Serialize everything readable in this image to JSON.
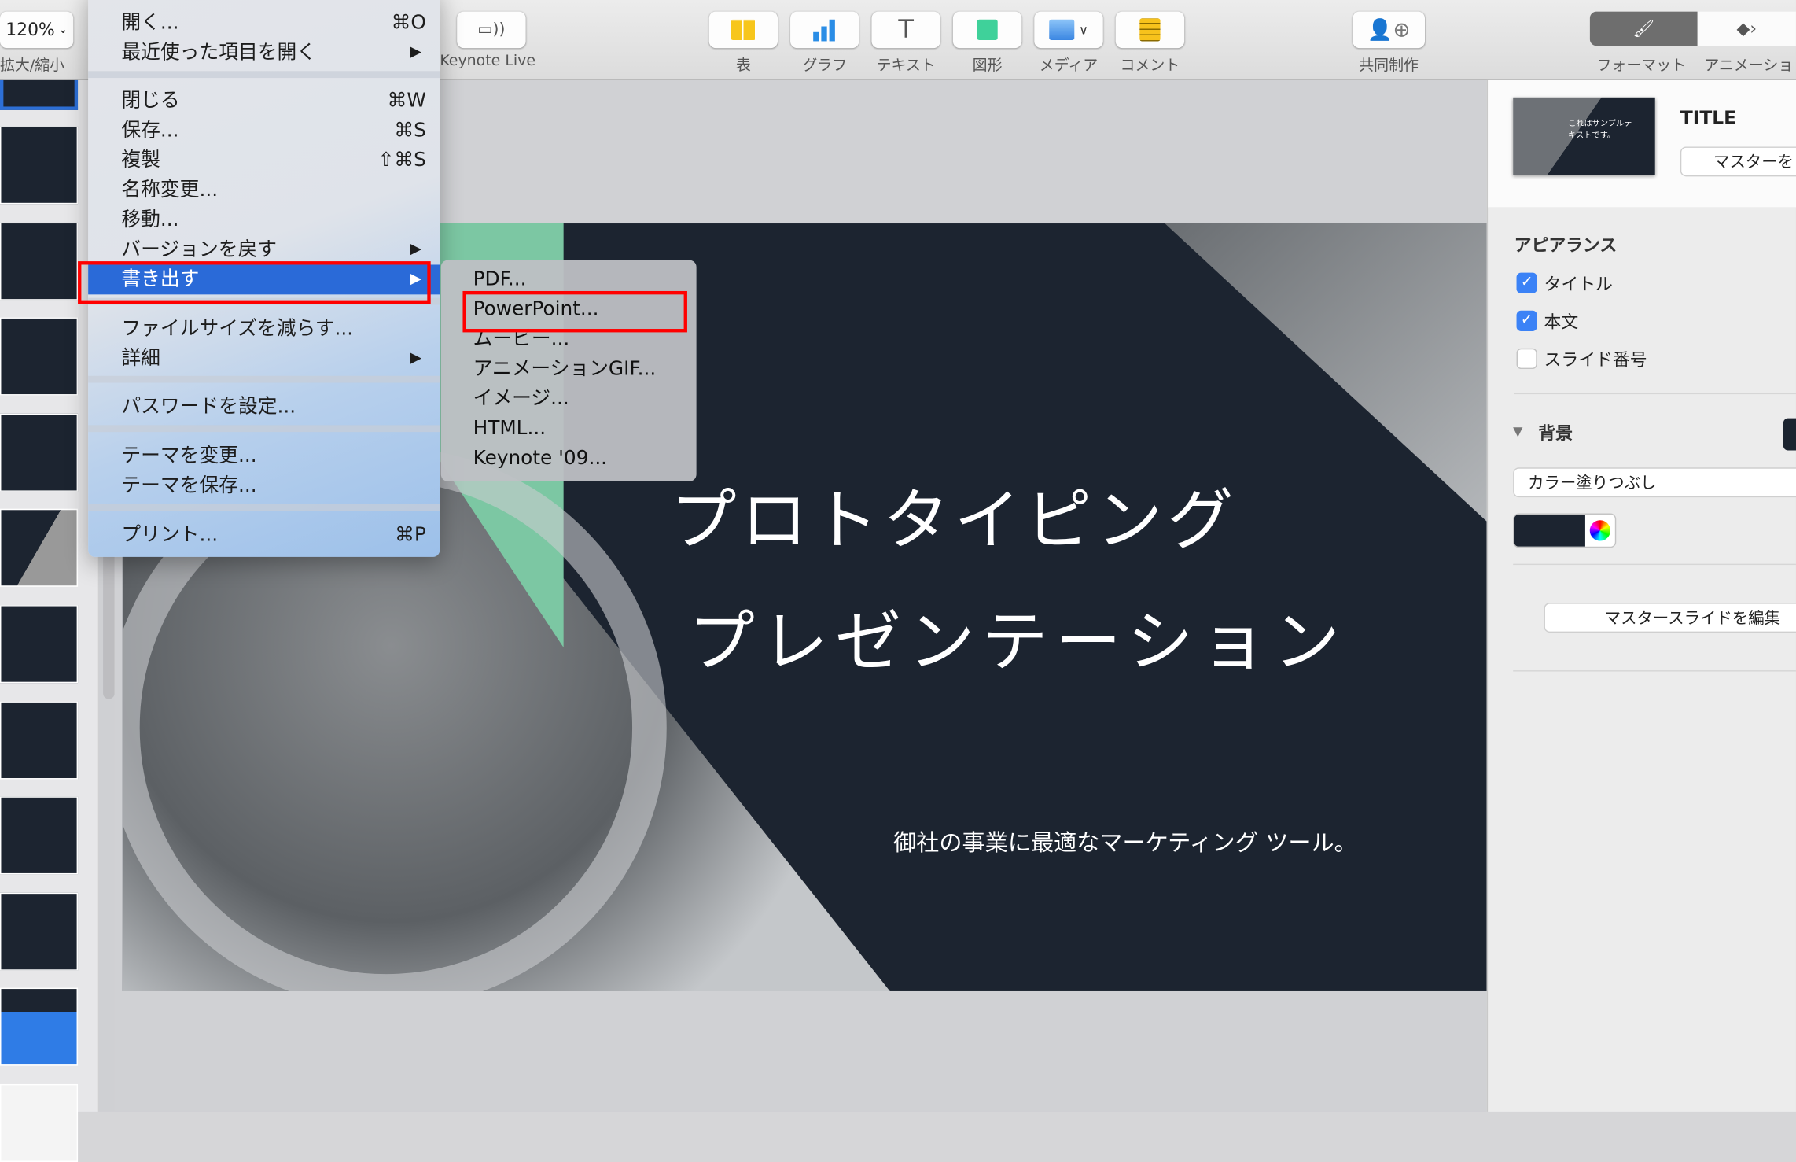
{
  "toolbar": {
    "zoom": {
      "value": "120%",
      "label": "拡大/縮小"
    },
    "keynote_live": "Keynote Live",
    "table": "表",
    "chart": "グラフ",
    "text": "テキスト",
    "shape": "図形",
    "media": "メディア",
    "comment": "コメント",
    "collaborate": "共同制作",
    "format": "フォーマット",
    "animate": "アニメーショ"
  },
  "file_menu": {
    "items": [
      {
        "label": "開く...",
        "shortcut": "⌘O"
      },
      {
        "label": "最近使った項目を開く",
        "submenu": true
      },
      {
        "label": "閉じる",
        "shortcut": "⌘W"
      },
      {
        "label": "保存...",
        "shortcut": "⌘S"
      },
      {
        "label": "複製",
        "shortcut": "⇧⌘S"
      },
      {
        "label": "名称変更..."
      },
      {
        "label": "移動..."
      },
      {
        "label": "バージョンを戻す",
        "submenu": true
      },
      {
        "label": "書き出す",
        "submenu": true,
        "selected": true
      },
      {
        "label": "ファイルサイズを減らす..."
      },
      {
        "label": "詳細",
        "submenu": true
      },
      {
        "label": "パスワードを設定..."
      },
      {
        "label": "テーマを変更..."
      },
      {
        "label": "テーマを保存..."
      },
      {
        "label": "プリント...",
        "shortcut": "⌘P"
      }
    ]
  },
  "export_submenu": {
    "items": [
      "PDF...",
      "PowerPoint...",
      "ムービー...",
      "アニメーションGIF...",
      "イメージ...",
      "HTML...",
      "Keynote '09..."
    ],
    "highlighted": "PowerPoint..."
  },
  "slide": {
    "title_line1": "プロトタイピング",
    "title_line2": "プレゼンテーション",
    "subtitle": "御社の事業に最適なマーケティング ツール。",
    "background_color": "#1c2430",
    "accent_green": "#7cc7a3",
    "accent_blue": "#1f5fc4"
  },
  "inspector": {
    "thumb_text": "これはサンプルテキストです。",
    "master_name": "TITLE",
    "master_button": "マスターを",
    "appearance_heading": "アピアランス",
    "checkboxes": [
      {
        "label": "タイトル",
        "checked": true
      },
      {
        "label": "本文",
        "checked": true
      },
      {
        "label": "スライド番号",
        "checked": false
      }
    ],
    "background_heading": "背景",
    "fill_type": "カラー塗りつぶし",
    "fill_color": "#1c2430",
    "edit_master_button": "マスタースライドを編集"
  },
  "highlight_color": "#ff0000"
}
